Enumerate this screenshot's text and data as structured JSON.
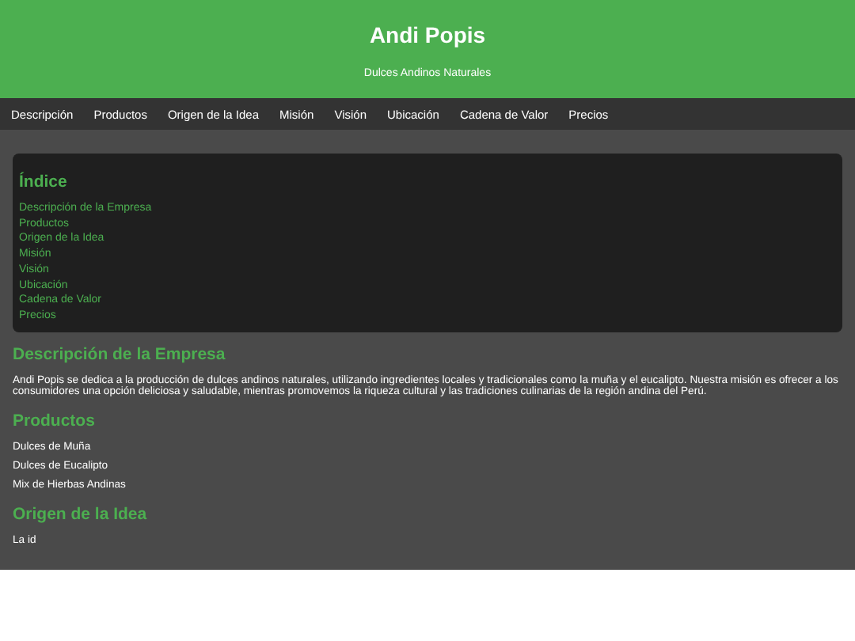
{
  "header": {
    "title": "Andi Popis",
    "subtitle": "Dulces Andinos Naturales"
  },
  "nav": [
    "Descripción",
    "Productos",
    "Origen de la Idea",
    "Misión",
    "Visión",
    "Ubicación",
    "Cadena de Valor",
    "Precios"
  ],
  "index": {
    "title": "Índice",
    "links": [
      "Descripción de la Empresa",
      "Productos",
      "Origen de la Idea",
      "Misión",
      "Visión",
      "Ubicación",
      "Cadena de Valor",
      "Precios"
    ]
  },
  "sections": [
    {
      "title": "Descripción de la Empresa",
      "kind": "paragraph",
      "text": "Andi Popis se dedica a la producción de dulces andinos naturales, utilizando ingredientes locales y tradicionales como la muña y el eucalipto. Nuestra misión es ofrecer a los consumidores una opción deliciosa y saludable, mientras promovemos la riqueza cultural y las tradiciones culinarias de la región andina del Perú."
    },
    {
      "title": "Productos",
      "kind": "list",
      "items": [
        "Dulces de Muña",
        "Dulces de Eucalipto",
        "Mix de Hierbas Andinas"
      ]
    },
    {
      "title": "Origen de la Idea",
      "kind": "paragraph",
      "text": "La id"
    }
  ]
}
